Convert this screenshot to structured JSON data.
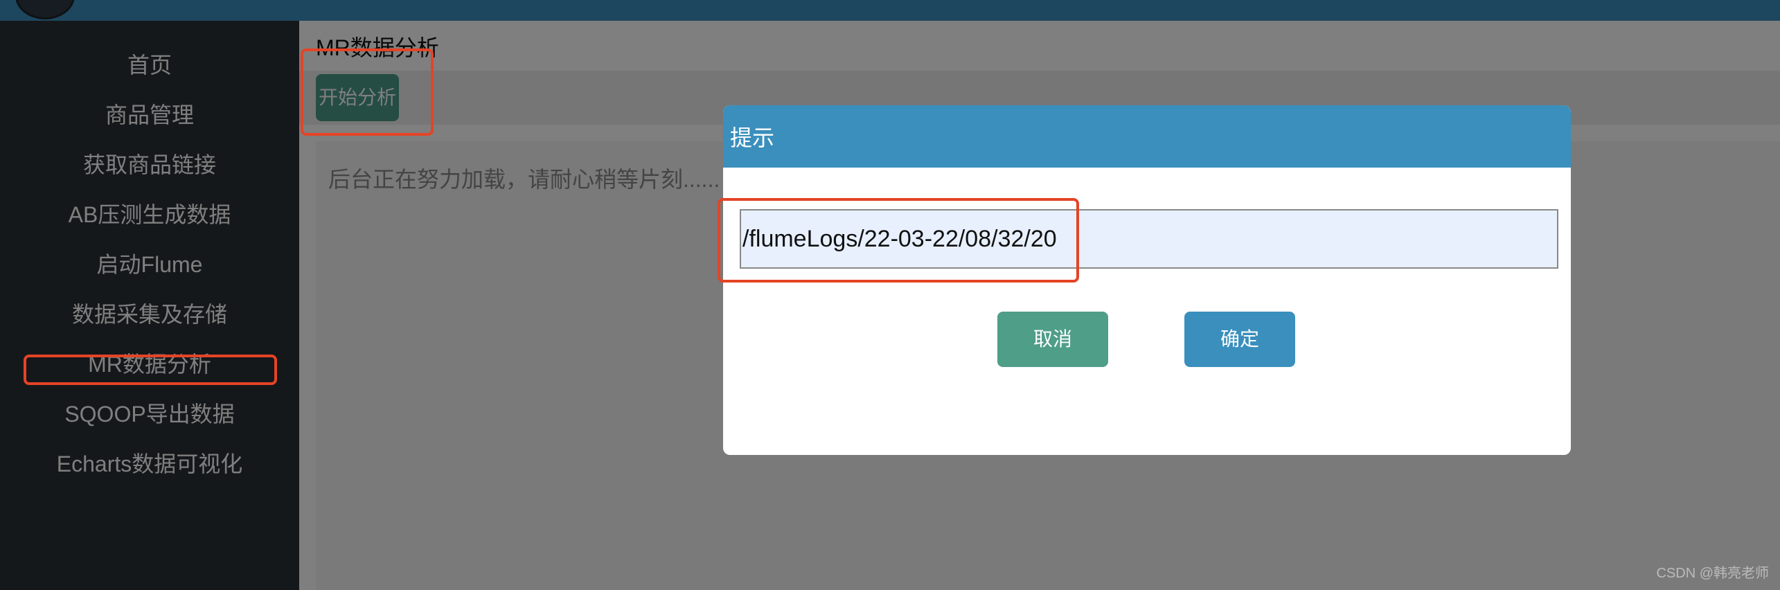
{
  "sidebar": {
    "items": [
      {
        "label": "首页"
      },
      {
        "label": "商品管理"
      },
      {
        "label": "获取商品链接"
      },
      {
        "label": "AB压测生成数据"
      },
      {
        "label": "启动Flume"
      },
      {
        "label": "数据采集及存储"
      },
      {
        "label": "MR数据分析"
      },
      {
        "label": "SQOOP导出数据"
      },
      {
        "label": "Echarts数据可视化"
      }
    ]
  },
  "main": {
    "title": "MR数据分析",
    "start_button": "开始分析",
    "loading_text": "后台正在努力加载，请耐心稍等片刻......"
  },
  "dialog": {
    "title": "提示",
    "input_value": "/flumeLogs/22-03-22/08/32/20",
    "cancel_label": "取消",
    "ok_label": "确定"
  },
  "watermark": "CSDN @韩亮老师",
  "colors": {
    "accent": "#3a8fbd",
    "sidebar_bg": "#2a3135",
    "cancel_button": "#4f9e88",
    "highlight_box": "#e44426"
  }
}
